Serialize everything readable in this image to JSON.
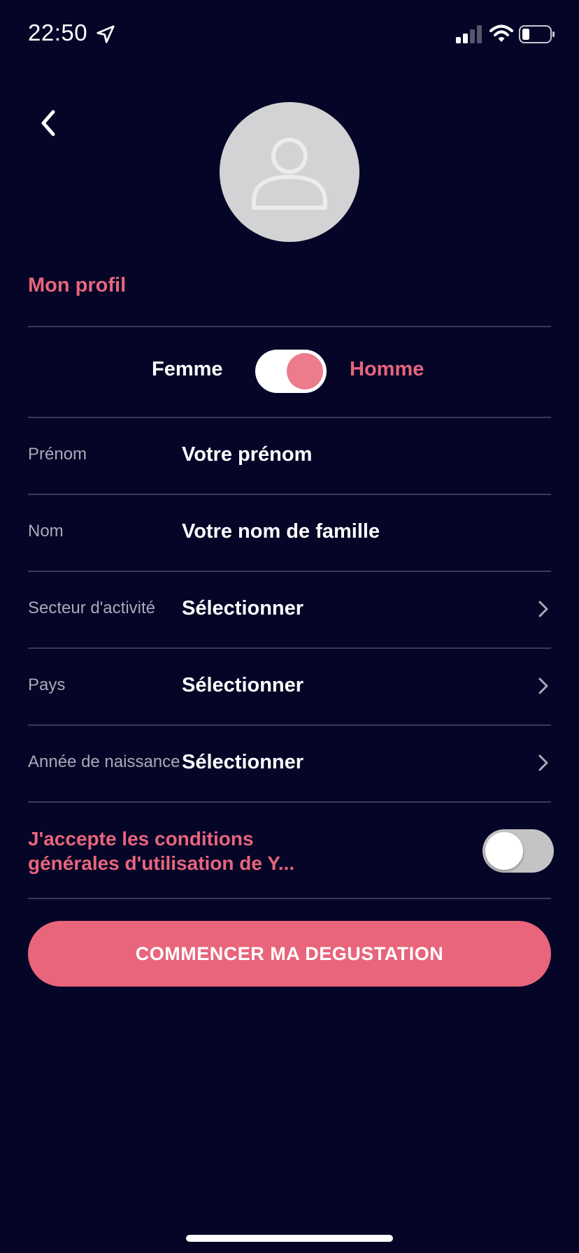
{
  "status_bar": {
    "time": "22:50",
    "icons": [
      "location-arrow-icon",
      "cellular-signal-icon",
      "wifi-icon",
      "battery-icon"
    ]
  },
  "header": {
    "back_icon": "chevron-left-icon",
    "avatar_icon": "user-placeholder-icon"
  },
  "profile": {
    "title": "Mon profil",
    "gender": {
      "left_label": "Femme",
      "right_label": "Homme",
      "selected": "Homme"
    },
    "fields": [
      {
        "label": "Prénom",
        "value": "Votre prénom",
        "has_chevron": false
      },
      {
        "label": "Nom",
        "value": "Votre nom de famille",
        "has_chevron": false
      },
      {
        "label": "Secteur d'activité",
        "value": "Sélectionner",
        "has_chevron": true
      },
      {
        "label": "Pays",
        "value": "Sélectionner",
        "has_chevron": true
      },
      {
        "label": "Année de naissance",
        "value": "Sélectionner",
        "has_chevron": true
      }
    ],
    "terms": {
      "line1": "J'accepte les conditions",
      "line2": "générales d'utilisation de Y...",
      "accepted": false
    }
  },
  "cta": {
    "label": "COMMENCER MA DEGUSTATION"
  },
  "colors": {
    "background": "#050527",
    "accent": "#e8657b",
    "divider": "#3a3a55",
    "muted_label": "#a9a9b8"
  }
}
